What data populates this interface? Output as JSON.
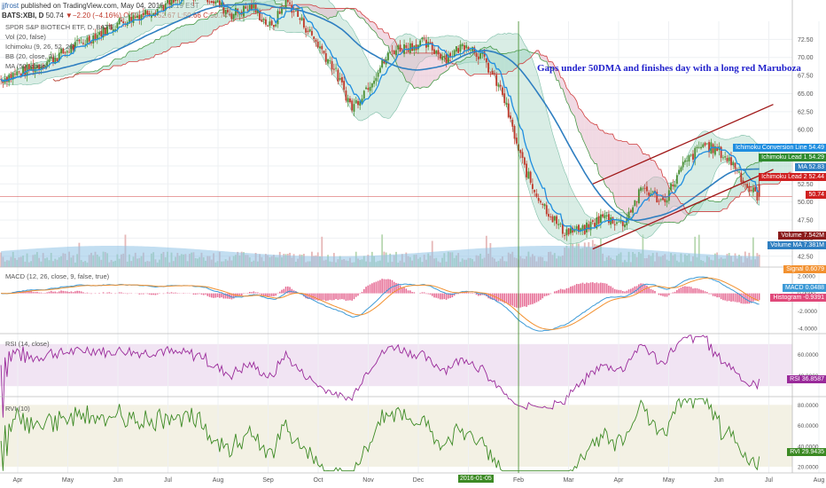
{
  "header": {
    "user": "jjfrost",
    "published": "published on TradingView.com, May 04, 2016 15:19 EST",
    "symbol": "BATS:XBI, D",
    "last": "50.74",
    "change": "▼−2.20 (−4.16%)",
    "ohlc": "O:52.49 H:52.67 L:50.66 C:50.74"
  },
  "legend": {
    "title": "SPDR S&P BIOTECH ETF, D, BATS",
    "vol": "Vol (20, false)",
    "ichimoku": "Ichimoku (9, 26, 52, 26)",
    "bb": "BB (20, close, 2)",
    "ma": "MA (50, close)"
  },
  "annotation": "Gaps under 50DMA and finishes day with a long red Maruboza",
  "macd_label": "MACD (12, 26, close, 9, false, true)",
  "rsi_label": "RSI (14, close)",
  "rvi_label": "RVI (10)",
  "colors": {
    "up": "#4a8f32",
    "down": "#c0392b",
    "ma": "#2f7fc1",
    "conv": "#1f8ee0",
    "cloud_red": "#e3b3c8",
    "cloud_green": "#9fd6c4",
    "bb": "#b9dfcf",
    "macd": "#3d9ad6",
    "signal": "#f29130",
    "hist": "#e0497a",
    "rsi": "#9a2a9a",
    "rvi": "#3c8a24"
  },
  "tags": {
    "conv": {
      "label": "Ichimoku Conversion Line",
      "value": "54.49"
    },
    "lead1": {
      "label": "Ichimoku Lead 1",
      "value": "54.29"
    },
    "ma": {
      "label": "MA",
      "value": "52.83"
    },
    "lead2": {
      "label": "Ichimoku Lead 2",
      "value": "52.44"
    },
    "price": {
      "value": "50.74"
    },
    "volume": {
      "label": "Volume",
      "value": "7.542M"
    },
    "volume_ma": {
      "label": "Volume MA",
      "value": "7.381M"
    },
    "signal": {
      "label": "Signal",
      "value": "0.6079"
    },
    "macd": {
      "label": "MACD",
      "value": "0.0488"
    },
    "histogram": {
      "label": "Histogram",
      "value": "-0.9391"
    },
    "rsi": {
      "label": "RSI",
      "value": "36.8587"
    },
    "rvi": {
      "label": "RVI",
      "value": "29.9435"
    }
  },
  "date_marker": "2016-01-05",
  "chart_data": [
    {
      "type": "candlestick",
      "name": "price",
      "x_ticks": [
        "Apr",
        "May",
        "Jun",
        "Jul",
        "Aug",
        "Sep",
        "Oct",
        "Nov",
        "Dec",
        "2016-01-05",
        "Feb",
        "Mar",
        "Apr",
        "May",
        "Jun",
        "Jul",
        "Aug"
      ],
      "y_ticks": [
        "72.50",
        "70.00",
        "67.50",
        "65.00",
        "62.50",
        "60.00",
        "57.50",
        "55.00",
        "52.50",
        "50.00",
        "47.50",
        "45.00",
        "42.50"
      ],
      "ylim": [
        41,
        75
      ],
      "price_keyframes": [
        [
          0,
          67
        ],
        [
          20,
          69
        ],
        [
          40,
          72
        ],
        [
          60,
          75
        ],
        [
          80,
          77
        ],
        [
          100,
          79
        ],
        [
          115,
          76
        ],
        [
          125,
          77
        ],
        [
          135,
          74
        ],
        [
          142,
          78
        ],
        [
          155,
          73
        ],
        [
          165,
          69
        ],
        [
          175,
          63
        ],
        [
          185,
          67
        ],
        [
          195,
          71
        ],
        [
          210,
          72
        ],
        [
          222,
          70
        ],
        [
          232,
          72
        ],
        [
          240,
          70
        ],
        [
          250,
          65
        ],
        [
          258,
          57
        ],
        [
          265,
          52
        ],
        [
          272,
          49
        ],
        [
          280,
          46
        ],
        [
          290,
          46
        ],
        [
          300,
          48
        ],
        [
          310,
          47
        ],
        [
          320,
          52
        ],
        [
          330,
          50
        ],
        [
          340,
          55
        ],
        [
          350,
          58
        ],
        [
          358,
          57
        ],
        [
          366,
          55
        ],
        [
          372,
          52
        ],
        [
          378,
          50.7
        ]
      ],
      "ichimoku_cloud_end": 50.5,
      "channel": {
        "upper": [
          [
            295,
            52.5
          ],
          [
            385,
            63.5
          ]
        ],
        "lower": [
          [
            295,
            43.5
          ],
          [
            385,
            54.5
          ]
        ]
      }
    },
    {
      "type": "bar",
      "name": "Volume",
      "ylim": [
        0,
        40
      ],
      "last": 7.542,
      "ma_last": 7.381
    },
    {
      "type": "line",
      "name": "MACD",
      "y_ticks": [
        "2.0000",
        "0.0000",
        "-2.0000",
        "-4.0000"
      ],
      "ylim": [
        -4.6,
        3.0
      ]
    },
    {
      "type": "line",
      "name": "RSI",
      "y_ticks": [
        "60.0000",
        "40.0000"
      ],
      "ylim": [
        20,
        80
      ],
      "band": [
        30,
        70
      ]
    },
    {
      "type": "line",
      "name": "RVI",
      "y_ticks": [
        "80.0000",
        "60.0000",
        "40.0000",
        "20.0000"
      ],
      "ylim": [
        14,
        88
      ],
      "band": [
        20,
        80
      ]
    }
  ]
}
